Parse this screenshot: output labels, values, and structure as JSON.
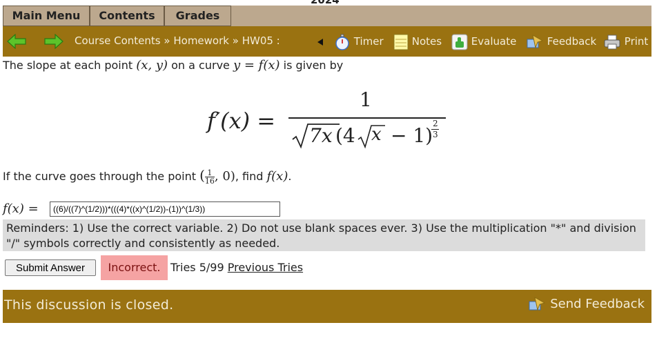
{
  "page": {
    "top_cut_text": "2024"
  },
  "tabs": [
    {
      "label": "Main Menu"
    },
    {
      "label": "Contents"
    },
    {
      "label": "Grades"
    }
  ],
  "nav": {
    "breadcrumbs": [
      "Course Contents",
      "Homework",
      "HW05 :"
    ],
    "breadcrumb_sep": "»",
    "tools": {
      "timer": "Timer",
      "notes": "Notes",
      "evaluate": "Evaluate",
      "feedback": "Feedback",
      "print": "Print"
    }
  },
  "problem": {
    "intro_1": "The slope at each point",
    "point_xy": "(x, y)",
    "intro_2": "on a curve",
    "curve_eq": "y = f(x)",
    "intro_3": "is given by",
    "formula": {
      "lhs": "f′(x) =",
      "numerator": "1",
      "den_radicand": "7x",
      "den_paren_open": "(4",
      "den_inner_radicand": "x",
      "den_paren_close": "− 1)",
      "exp_num": "2",
      "exp_den": "3"
    },
    "question_1": "If the curve goes through the point",
    "point_num": "1",
    "point_den": "16",
    "point_rest": ", 0)",
    "point_open": "(",
    "question_2": ", find",
    "question_fx": "f(x)",
    "question_end": "."
  },
  "answer": {
    "label": "f(x) =",
    "value": "((6)/((7)^(1/2)))*(((4)*((x)^(1/2))-(1))^(1/3))"
  },
  "reminder": "Reminders: 1) Use the correct variable. 2) Do not use blank spaces ever. 3) Use the multiplication \"*\" and division \"/\" symbols correctly and consistently as needed.",
  "status": {
    "submit_label": "Submit Answer",
    "result": "Incorrect.",
    "tries": "Tries 5/99",
    "previous_tries": "Previous Tries"
  },
  "discussion": {
    "closed_text": "This discussion is closed.",
    "send_feedback": "Send Feedback"
  },
  "colors": {
    "tabbar": "#bca88e",
    "navbar": "#9a7211",
    "incorrect_bg": "#f5a3a3",
    "reminder_bg": "#dcdcdc"
  }
}
